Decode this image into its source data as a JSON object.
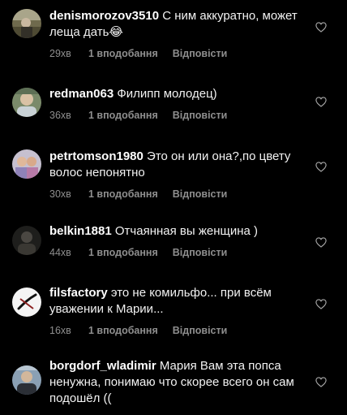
{
  "comments": [
    {
      "username": "denismorozov3510",
      "text": "С ним аккуратно, может леща дать😂",
      "time": "29хв",
      "likes": "1 вподобання",
      "reply": "Відповісти",
      "avatar_icon": "photo-avatar"
    },
    {
      "username": "redman063",
      "text": "Филипп молодец)",
      "time": "36хв",
      "likes": "1 вподобання",
      "reply": "Відповісти",
      "avatar_icon": "photo-avatar"
    },
    {
      "username": "petrtomson1980",
      "text": "Это он или она?,по цвету волос непонятно",
      "time": "30хв",
      "likes": "1 вподобання",
      "reply": "Відповісти",
      "avatar_icon": "photo-avatar"
    },
    {
      "username": "belkin1881",
      "text": "Отчаянная вы женщина )",
      "time": "44хв",
      "likes": "1 вподобання",
      "reply": "Відповісти",
      "avatar_icon": "photo-avatar"
    },
    {
      "username": "filsfactory",
      "text": "это не комильфо... при всём уважении к Марии...",
      "time": "16хв",
      "likes": "1 вподобання",
      "reply": "Відповісти",
      "avatar_icon": "logo-avatar"
    },
    {
      "username": "borgdorf_wladimir",
      "text": "Мария Вам эта попса ненужна, понимаю что скорее всего он сам подошёл ((",
      "time": "",
      "likes": "",
      "reply": "",
      "avatar_icon": "photo-avatar"
    }
  ],
  "icons": {
    "like": "heart-outline-icon"
  },
  "colors": {
    "background": "#000000",
    "text": "#f2f2f2",
    "meta": "#8e8e8e"
  }
}
